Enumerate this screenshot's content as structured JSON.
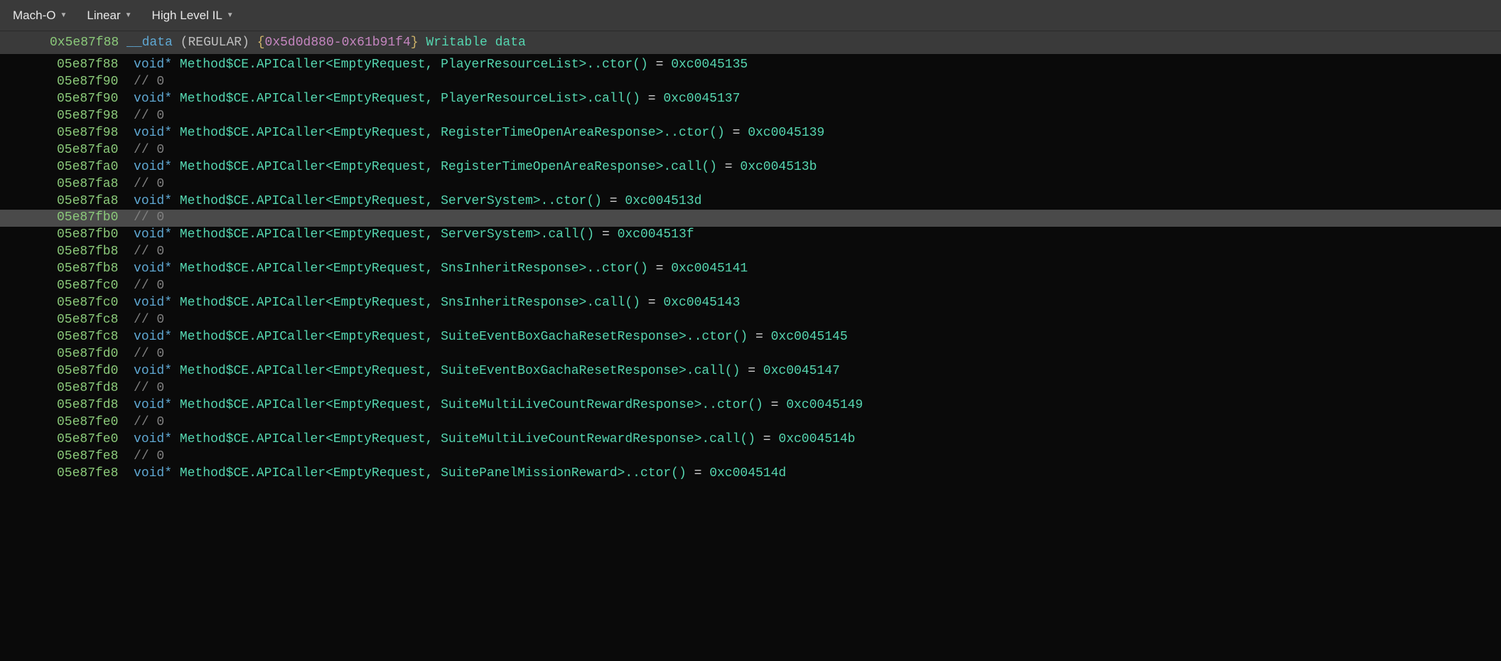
{
  "toolbar": {
    "format": "Mach-O",
    "mode": "Linear",
    "il": "High Level IL"
  },
  "section": {
    "addr": "0x5e87f88",
    "name": "__data",
    "type": "REGULAR",
    "range_start": "0x5d0d880",
    "range_end": "0x61b91f4",
    "desc": "Writable data"
  },
  "lines": [
    {
      "addr": "05e87f88",
      "type": "void*",
      "symbol": "Method$CE.APICaller<EmptyRequest, PlayerResourceList>..ctor()",
      "value": "0xc0045135"
    },
    {
      "addr": "05e87f90",
      "comment": "// 0"
    },
    {
      "addr": "05e87f90",
      "type": "void*",
      "symbol": "Method$CE.APICaller<EmptyRequest, PlayerResourceList>.call()",
      "value": "0xc0045137"
    },
    {
      "addr": "05e87f98",
      "comment": "// 0"
    },
    {
      "addr": "05e87f98",
      "type": "void*",
      "symbol": "Method$CE.APICaller<EmptyRequest, RegisterTimeOpenAreaResponse>..ctor()",
      "value": "0xc0045139"
    },
    {
      "addr": "05e87fa0",
      "comment": "// 0"
    },
    {
      "addr": "05e87fa0",
      "type": "void*",
      "symbol": "Method$CE.APICaller<EmptyRequest, RegisterTimeOpenAreaResponse>.call()",
      "value": "0xc004513b"
    },
    {
      "addr": "05e87fa8",
      "comment": "// 0"
    },
    {
      "addr": "05e87fa8",
      "type": "void*",
      "symbol": "Method$CE.APICaller<EmptyRequest, ServerSystem>..ctor()",
      "value": "0xc004513d"
    },
    {
      "addr": "05e87fb0",
      "comment": "// 0",
      "highlighted": true
    },
    {
      "addr": "05e87fb0",
      "type": "void*",
      "symbol": "Method$CE.APICaller<EmptyRequest, ServerSystem>.call()",
      "value": "0xc004513f"
    },
    {
      "addr": "05e87fb8",
      "comment": "// 0"
    },
    {
      "addr": "05e87fb8",
      "type": "void*",
      "symbol": "Method$CE.APICaller<EmptyRequest, SnsInheritResponse>..ctor()",
      "value": "0xc0045141"
    },
    {
      "addr": "05e87fc0",
      "comment": "// 0"
    },
    {
      "addr": "05e87fc0",
      "type": "void*",
      "symbol": "Method$CE.APICaller<EmptyRequest, SnsInheritResponse>.call()",
      "value": "0xc0045143"
    },
    {
      "addr": "05e87fc8",
      "comment": "// 0"
    },
    {
      "addr": "05e87fc8",
      "type": "void*",
      "symbol": "Method$CE.APICaller<EmptyRequest, SuiteEventBoxGachaResetResponse>..ctor()",
      "value": "0xc0045145"
    },
    {
      "addr": "05e87fd0",
      "comment": "// 0"
    },
    {
      "addr": "05e87fd0",
      "type": "void*",
      "symbol": "Method$CE.APICaller<EmptyRequest, SuiteEventBoxGachaResetResponse>.call()",
      "value": "0xc0045147"
    },
    {
      "addr": "05e87fd8",
      "comment": "// 0"
    },
    {
      "addr": "05e87fd8",
      "type": "void*",
      "symbol": "Method$CE.APICaller<EmptyRequest, SuiteMultiLiveCountRewardResponse>..ctor()",
      "value": "0xc0045149"
    },
    {
      "addr": "05e87fe0",
      "comment": "// 0"
    },
    {
      "addr": "05e87fe0",
      "type": "void*",
      "symbol": "Method$CE.APICaller<EmptyRequest, SuiteMultiLiveCountRewardResponse>.call()",
      "value": "0xc004514b"
    },
    {
      "addr": "05e87fe8",
      "comment": "// 0"
    },
    {
      "addr": "05e87fe8",
      "type": "void*",
      "symbol": "Method$CE.APICaller<EmptyRequest, SuitePanelMissionReward>..ctor()",
      "value": "0xc004514d"
    }
  ]
}
